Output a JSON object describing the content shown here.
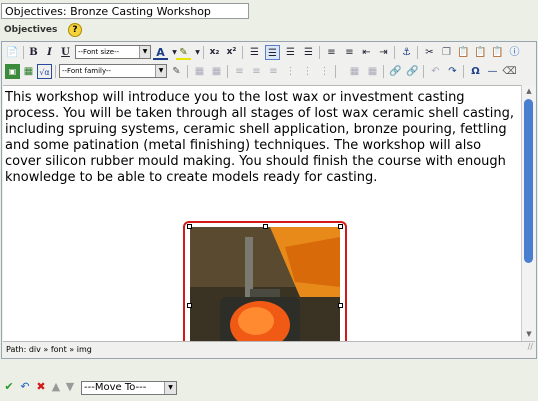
{
  "title_field": {
    "value": "Objectives: Bronze Casting Workshop"
  },
  "section": {
    "label": "Objectives"
  },
  "toolbar": {
    "font_size_label": "--Font size--",
    "font_family_label": "--Font family--",
    "bold": "B",
    "italic": "I",
    "underline": "U",
    "subscript": "x₂",
    "superscript": "x²",
    "omega": "Ω"
  },
  "editor": {
    "body_text": "This workshop will introduce you to the lost wax or investment casting process. You will be taken through all stages of lost wax ceramic shell casting, including spruing systems, ceramic shell application, bronze pouring, fettling and some patination (metal finishing) techniques. The workshop will also cover silicon rubber mould making. You should finish the course with enough knowledge to be able to create models ready for casting.",
    "status_path": "Path: div » font » img"
  },
  "bottom_bar": {
    "move_to": "---Move To---"
  },
  "colors": {
    "selection_border": "#d31a1a",
    "scroll_thumb": "#4a7fd0",
    "background": "#ecefe6"
  }
}
